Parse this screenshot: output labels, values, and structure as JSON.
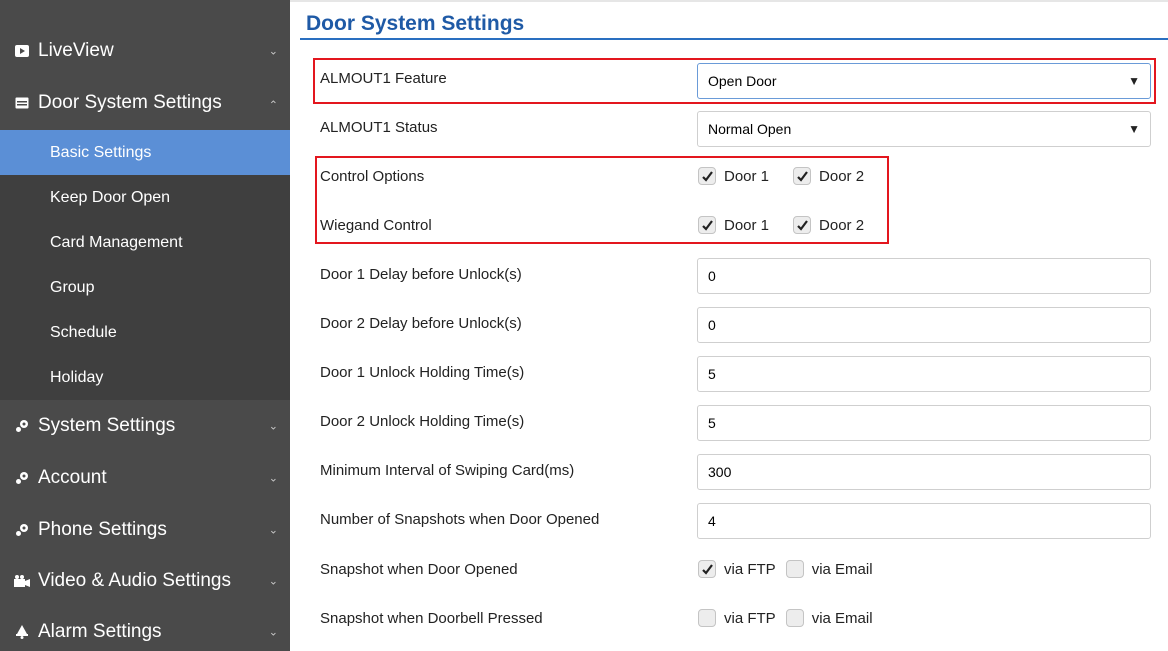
{
  "sidebar": {
    "items": [
      {
        "label": "LiveView",
        "icon": "video-icon"
      },
      {
        "label": "Door System Settings",
        "icon": "door-panel-icon"
      },
      {
        "label": "System Settings",
        "icon": "gear-icon"
      },
      {
        "label": "Account",
        "icon": "gear-icon"
      },
      {
        "label": "Phone Settings",
        "icon": "gear-icon"
      },
      {
        "label": "Video & Audio Settings",
        "icon": "camera-audio-icon"
      },
      {
        "label": "Alarm Settings",
        "icon": "bell-icon"
      }
    ],
    "sub_items": [
      "Basic Settings",
      "Keep Door Open",
      "Card Management",
      "Group",
      "Schedule",
      "Holiday"
    ],
    "active_sub": "Basic Settings",
    "active_color": "#5b8fd6",
    "bg_color": "#4a4a4a"
  },
  "main": {
    "title": "Door System Settings",
    "title_color": "#1f5aa6",
    "almout1_feature": {
      "label": "ALMOUT1 Feature",
      "value": "Open Door"
    },
    "almout1_status": {
      "label": "ALMOUT1 Status",
      "value": "Normal Open"
    },
    "control_options": {
      "label": "Control Options",
      "door1": "Door 1",
      "door2": "Door 2",
      "door1_checked": true,
      "door2_checked": true
    },
    "wiegand_control": {
      "label": "Wiegand Control",
      "door1": "Door 1",
      "door2": "Door 2",
      "door1_checked": true,
      "door2_checked": true
    },
    "door1_delay": {
      "label": "Door 1 Delay before Unlock(s)",
      "value": "0"
    },
    "door2_delay": {
      "label": "Door 2 Delay before Unlock(s)",
      "value": "0"
    },
    "door1_holding": {
      "label": "Door 1 Unlock Holding Time(s)",
      "value": "5"
    },
    "door2_holding": {
      "label": "Door 2 Unlock Holding Time(s)",
      "value": "5"
    },
    "min_interval": {
      "label": "Minimum Interval of Swiping Card(ms)",
      "value": "300"
    },
    "snapshots_count": {
      "label": "Number of Snapshots when Door Opened",
      "value": "4"
    },
    "snapshot_door_opened": {
      "label": "Snapshot when Door Opened",
      "ftp": "via FTP",
      "email": "via Email",
      "ftp_checked": true,
      "email_checked": false
    },
    "snapshot_doorbell": {
      "label": "Snapshot when Doorbell Pressed",
      "ftp": "via FTP",
      "email": "via Email",
      "ftp_checked": false,
      "email_checked": false
    }
  },
  "highlight_color": "#e3161e"
}
